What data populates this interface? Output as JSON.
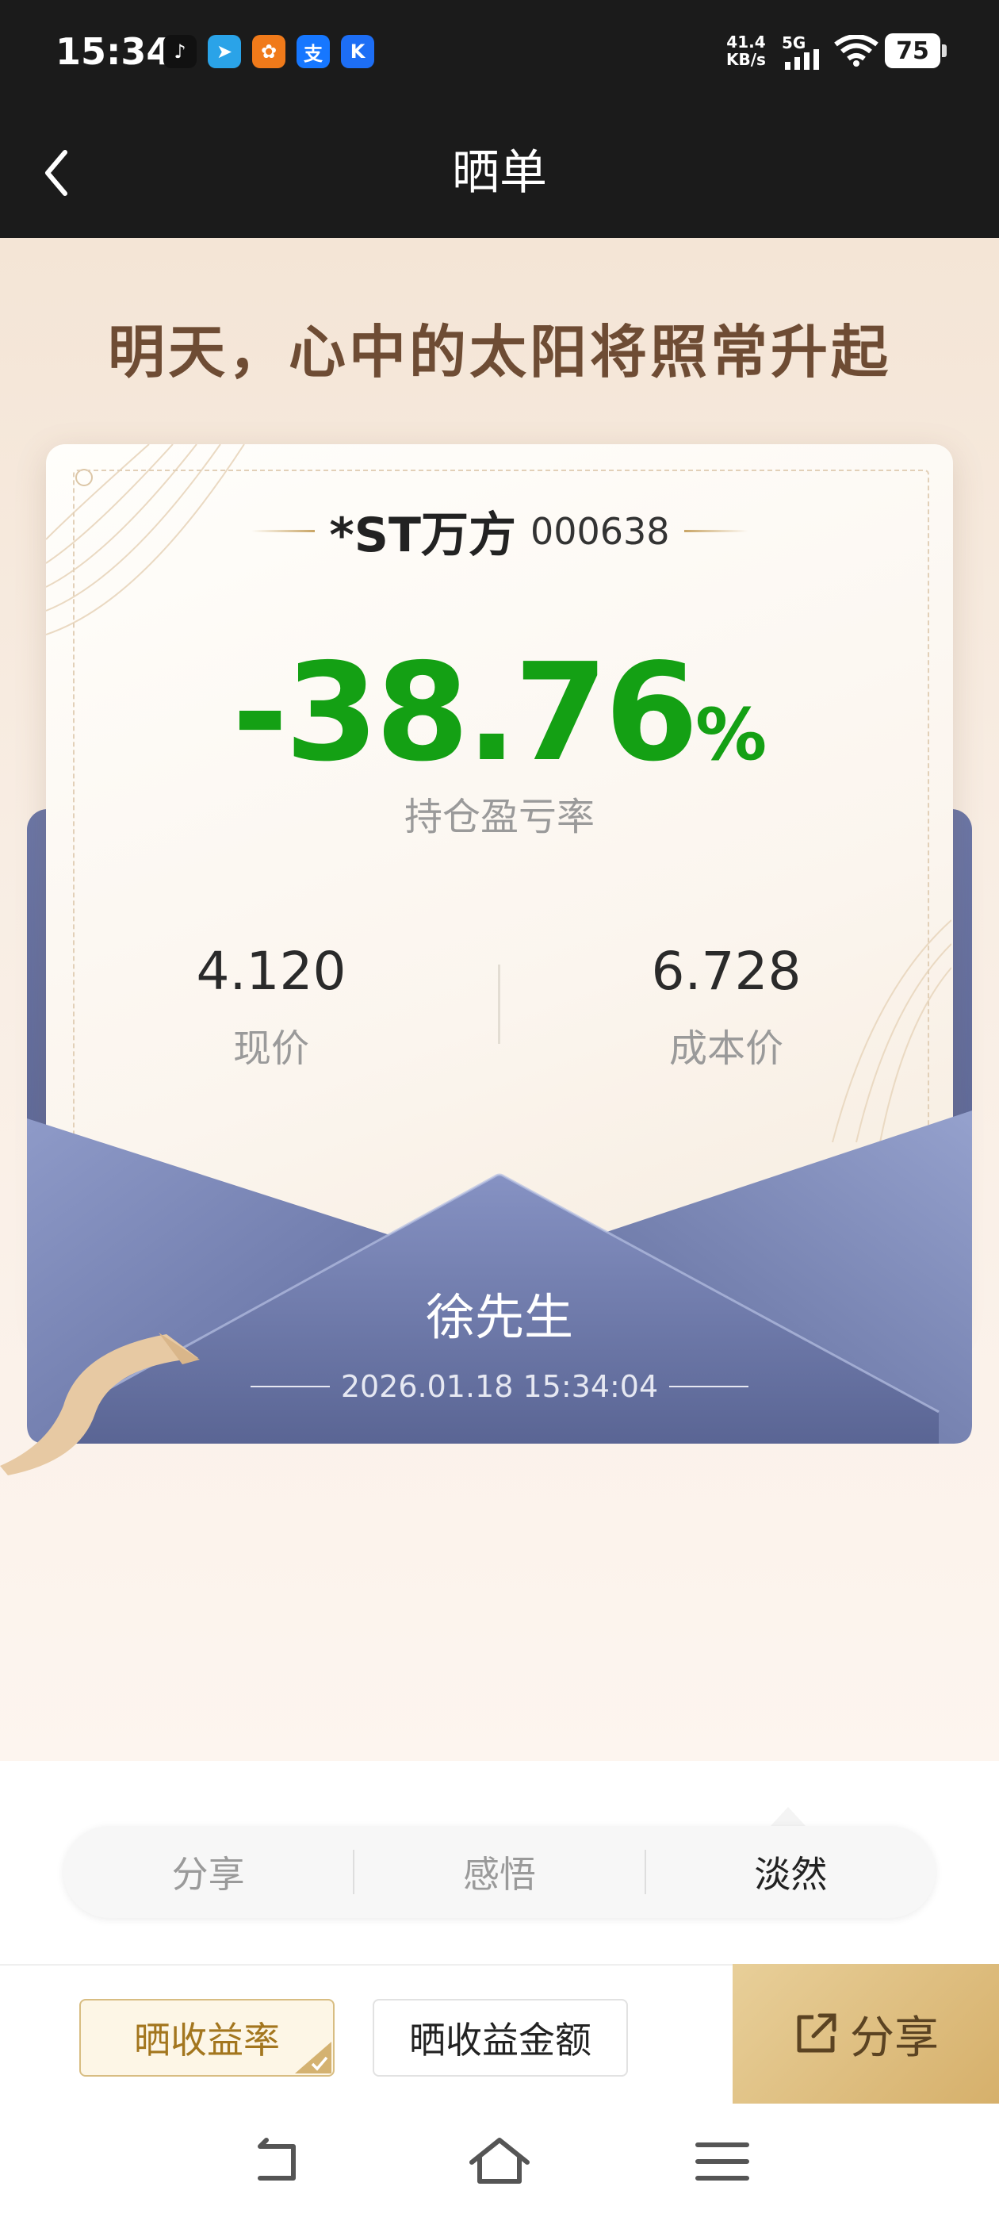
{
  "status_bar": {
    "time": "15:34",
    "app_icons": [
      {
        "name": "tiktok-icon",
        "glyph": "♪",
        "color": "#111111"
      },
      {
        "name": "telegram-icon",
        "glyph": "➤",
        "color": "#2aa3e8"
      },
      {
        "name": "app-orange-icon",
        "glyph": "✿",
        "color": "#f07a1a"
      },
      {
        "name": "alipay-icon",
        "glyph": "支",
        "color": "#1677ff"
      },
      {
        "name": "k-app-icon",
        "glyph": "K",
        "color": "#1d6ef5"
      }
    ],
    "net_speed_value": "41.4",
    "net_speed_unit": "KB/s",
    "network": "5G",
    "battery": "75"
  },
  "nav": {
    "title": "晒单"
  },
  "slogan": "明天，心中的太阳将照常升起",
  "stock": {
    "name": "*ST万方",
    "code": "000638"
  },
  "profit": {
    "rate": "-38.76",
    "percent_sign": "%",
    "label": "持仓盈亏率",
    "color": "#14a014"
  },
  "prices": {
    "current_value": "4.120",
    "current_label": "现价",
    "cost_value": "6.728",
    "cost_label": "成本价"
  },
  "envelope": {
    "name": "徐先生",
    "datetime": "2026.01.18 15:34:04"
  },
  "tabs": [
    {
      "label": "分享",
      "active": false
    },
    {
      "label": "感悟",
      "active": false
    },
    {
      "label": "淡然",
      "active": true
    }
  ],
  "actions": {
    "show_rate": "晒收益率",
    "show_amount": "晒收益金额",
    "share": "分享"
  },
  "colors": {
    "accent_gold": "#d6b06b",
    "envelope_blue": "#6b76a6"
  }
}
